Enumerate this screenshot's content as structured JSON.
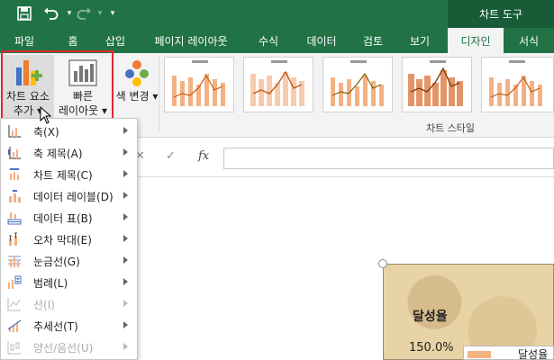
{
  "quick_access": {
    "save_icon": "save-icon",
    "undo_icon": "undo-icon",
    "redo_icon": "redo-icon",
    "customize_icon": "customize-icon"
  },
  "context_tab": {
    "label": "차트 도구"
  },
  "tabs": [
    {
      "label": "파일"
    },
    {
      "label": "홈"
    },
    {
      "label": "삽입"
    },
    {
      "label": "페이지 레이아웃"
    },
    {
      "label": "수식"
    },
    {
      "label": "데이터"
    },
    {
      "label": "검토"
    },
    {
      "label": "보기"
    },
    {
      "label": "디자인"
    },
    {
      "label": "서식"
    }
  ],
  "ribbon": {
    "add_element": {
      "line1": "차트 요소",
      "line2": "추가"
    },
    "quick_layout": {
      "line1": "빠른",
      "line2": "레이아웃"
    },
    "change_color": {
      "label": "색 변경"
    },
    "chart_styles_label": "차트 스타일"
  },
  "formula_bar": {
    "cancel": "✕",
    "confirm": "✓",
    "fx": "fx"
  },
  "menu": {
    "items": [
      {
        "label": "축(X)",
        "icon": "axis-icon",
        "disabled": false
      },
      {
        "label": "축 제목(A)",
        "icon": "axis-title-icon",
        "disabled": false
      },
      {
        "label": "차트 제목(C)",
        "icon": "chart-title-icon",
        "disabled": false
      },
      {
        "label": "데이터 레이블(D)",
        "icon": "data-labels-icon",
        "disabled": false
      },
      {
        "label": "데이터 표(B)",
        "icon": "data-table-icon",
        "disabled": false
      },
      {
        "label": "오차 막대(E)",
        "icon": "error-bars-icon",
        "disabled": false
      },
      {
        "label": "눈금선(G)",
        "icon": "gridlines-icon",
        "disabled": false
      },
      {
        "label": "범례(L)",
        "icon": "legend-icon",
        "disabled": false
      },
      {
        "label": "선(I)",
        "icon": "lines-icon",
        "disabled": true
      },
      {
        "label": "추세선(T)",
        "icon": "trendline-icon",
        "disabled": false
      },
      {
        "label": "양선/음선(U)",
        "icon": "up-down-bars-icon",
        "disabled": true
      }
    ]
  },
  "chart": {
    "title": "달성율",
    "tick_label": "150.0%",
    "legend_label": "달성율",
    "background_color": "#e8d3a6",
    "series_color": "#f4b183"
  },
  "colors": {
    "excel_green": "#217346",
    "context_green": "#185c37",
    "highlight_red": "#e0282f"
  }
}
